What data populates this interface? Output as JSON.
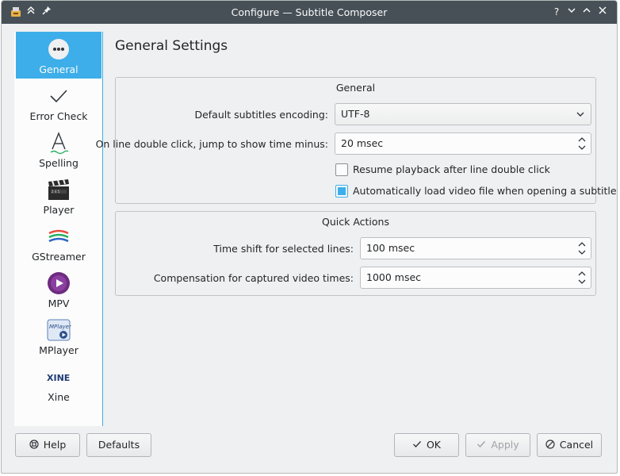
{
  "window": {
    "title": "Configure — Subtitle Composer"
  },
  "sidebar": {
    "items": [
      {
        "label": "General",
        "icon": "dots-icon",
        "active": true
      },
      {
        "label": "Error Check",
        "icon": "checkmark-icon"
      },
      {
        "label": "Spelling",
        "icon": "spelling-icon"
      },
      {
        "label": "Player",
        "icon": "clapperboard-icon"
      },
      {
        "label": "GStreamer",
        "icon": "gstreamer-icon"
      },
      {
        "label": "MPV",
        "icon": "mpv-icon"
      },
      {
        "label": "MPlayer",
        "icon": "mplayer-icon"
      },
      {
        "label": "Xine",
        "icon": "xine-icon"
      }
    ],
    "icon_text": {
      "mplayer": "MPlayer",
      "xine": "XINE"
    }
  },
  "page": {
    "title": "General Settings"
  },
  "general": {
    "title": "General",
    "encoding_label": "Default subtitles encoding:",
    "encoding_value": "UTF-8",
    "jump_label": "On line double click, jump to show time minus:",
    "jump_value": "20 msec",
    "resume_label": "Resume playback after line double click",
    "resume_checked": false,
    "autoload_label": "Automatically load video file when opening a subtitle",
    "autoload_checked": true
  },
  "quick_actions": {
    "title": "Quick Actions",
    "shift_label": "Time shift for selected lines:",
    "shift_value": "100 msec",
    "compensation_label": "Compensation for captured video times:",
    "compensation_value": "1000 msec"
  },
  "buttons": {
    "help": "Help",
    "defaults": "Defaults",
    "ok": "OK",
    "apply": "Apply",
    "cancel": "Cancel"
  },
  "colors": {
    "accent": "#3daee9",
    "titlebar": "#475057",
    "window_bg": "#eff0f1"
  }
}
